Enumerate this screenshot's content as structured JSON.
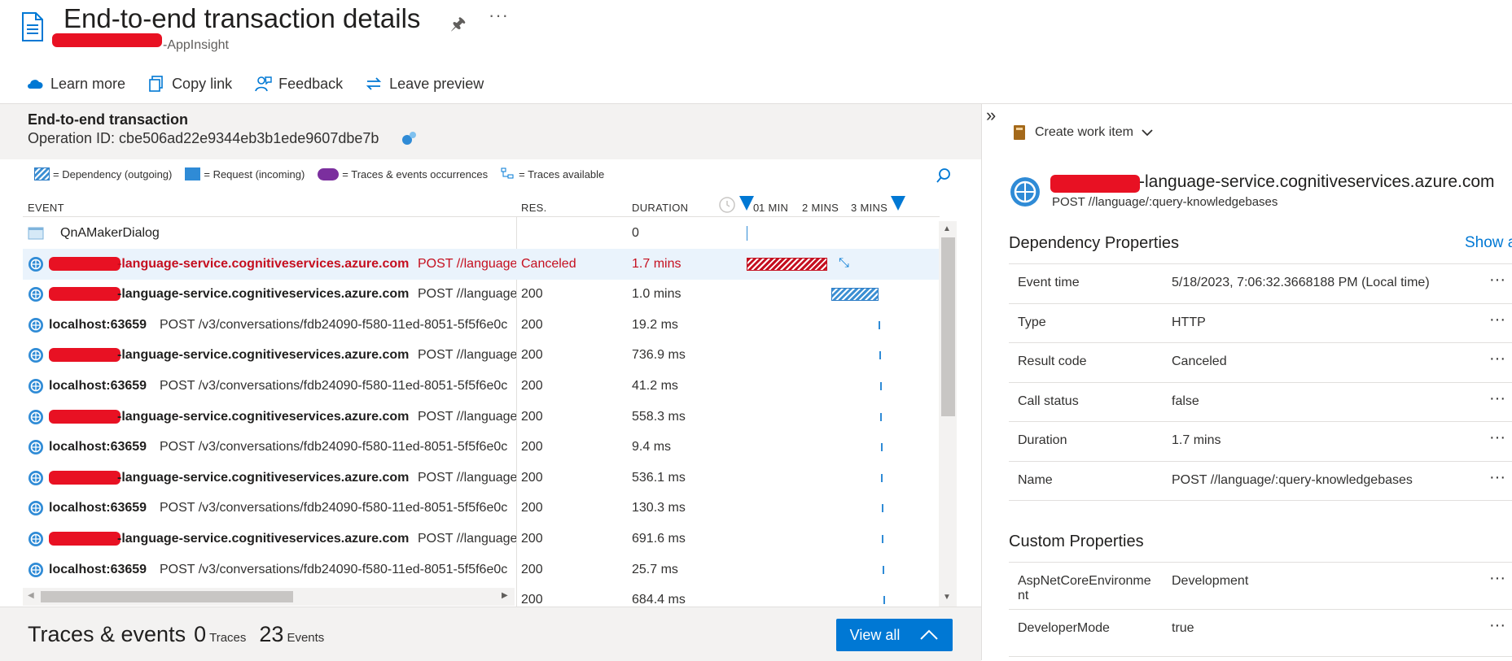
{
  "header": {
    "title": "End-to-end transaction details",
    "subtitle_suffix": "-AppInsight",
    "more_label": "···"
  },
  "toolbar": {
    "learn_more": "Learn more",
    "copy_link": "Copy link",
    "feedback": "Feedback",
    "leave_preview": "Leave preview"
  },
  "transaction": {
    "title": "End-to-end transaction",
    "operation_id": "Operation ID: cbe506ad22e9344eb3b1ede9607dbe7b"
  },
  "legend": {
    "dependency": "= Dependency (outgoing)",
    "request": "= Request (incoming)",
    "traces": "= Traces & events occurrences",
    "traces_available": "= Traces available"
  },
  "columns": {
    "event": "EVENT",
    "res": "RES.",
    "duration": "DURATION",
    "tick0": "0",
    "tick1": "1 MIN",
    "tick2": "2 MINS",
    "tick3": "3 MINS"
  },
  "rows": [
    {
      "name": "QnAMakerDialog",
      "detail": "",
      "res": "",
      "duration": "0",
      "bar_start": 0.0,
      "bar_len": 0.0
    },
    {
      "name": "-language-service.cognitiveservices.azure.com",
      "detail": "POST //language",
      "res": "Canceled",
      "duration": "1.7 mins",
      "bar_start": 0.0,
      "bar_len": 1.7
    },
    {
      "name": "-language-service.cognitiveservices.azure.com",
      "detail": "POST //language",
      "res": "200",
      "duration": "1.0 mins",
      "bar_start": 1.8,
      "bar_len": 1.0
    },
    {
      "name": "localhost:63659",
      "detail": "POST /v3/conversations/fdb24090-f580-11ed-8051-5f5f6e0c",
      "res": "200",
      "duration": "19.2 ms",
      "bar_start": 2.8,
      "bar_len": 0.0
    },
    {
      "name": "-language-service.cognitiveservices.azure.com",
      "detail": "POST //language",
      "res": "200",
      "duration": "736.9 ms",
      "bar_start": 2.81,
      "bar_len": 0.01
    },
    {
      "name": "localhost:63659",
      "detail": "POST /v3/conversations/fdb24090-f580-11ed-8051-5f5f6e0c",
      "res": "200",
      "duration": "41.2 ms",
      "bar_start": 2.82,
      "bar_len": 0.0
    },
    {
      "name": "-language-service.cognitiveservices.azure.com",
      "detail": "POST //language",
      "res": "200",
      "duration": "558.3 ms",
      "bar_start": 2.83,
      "bar_len": 0.01
    },
    {
      "name": "localhost:63659",
      "detail": "POST /v3/conversations/fdb24090-f580-11ed-8051-5f5f6e0c",
      "res": "200",
      "duration": "9.4 ms",
      "bar_start": 2.84,
      "bar_len": 0.0
    },
    {
      "name": "-language-service.cognitiveservices.azure.com",
      "detail": "POST //language",
      "res": "200",
      "duration": "536.1 ms",
      "bar_start": 2.85,
      "bar_len": 0.01
    },
    {
      "name": "localhost:63659",
      "detail": "POST /v3/conversations/fdb24090-f580-11ed-8051-5f5f6e0c",
      "res": "200",
      "duration": "130.3 ms",
      "bar_start": 2.86,
      "bar_len": 0.0
    },
    {
      "name": "-language-service.cognitiveservices.azure.com",
      "detail": "POST //language",
      "res": "200",
      "duration": "691.6 ms",
      "bar_start": 2.87,
      "bar_len": 0.01
    },
    {
      "name": "localhost:63659",
      "detail": "POST /v3/conversations/fdb24090-f580-11ed-8051-5f5f6e0c",
      "res": "200",
      "duration": "25.7 ms",
      "bar_start": 2.88,
      "bar_len": 0.0
    },
    {
      "name": "",
      "detail": "",
      "res": "200",
      "duration": "684.4 ms",
      "bar_start": 2.89,
      "bar_len": 0.01
    }
  ],
  "footer": {
    "title": "Traces & events",
    "traces_count": "0",
    "traces_label": "Traces",
    "events_count": "23",
    "events_label": "Events",
    "view_all": "View all"
  },
  "right_panel": {
    "collapse": "»",
    "create_work_item": "Create work item",
    "name_suffix": "-language-service.cognitiveservices.azure.com",
    "name_sub": "POST //language/:query-knowledgebases",
    "dependency_heading": "Dependency Properties",
    "show_all": "Show a",
    "properties": [
      {
        "label": "Event time",
        "value": "5/18/2023, 7:06:32.3668188 PM (Local time)"
      },
      {
        "label": "Type",
        "value": "HTTP"
      },
      {
        "label": "Result code",
        "value": "Canceled"
      },
      {
        "label": "Call status",
        "value": "false"
      },
      {
        "label": "Duration",
        "value": "1.7 mins"
      },
      {
        "label": "Name",
        "value": "POST //language/:query-knowledgebases"
      }
    ],
    "custom_heading": "Custom Properties",
    "custom": [
      {
        "label": "AspNetCoreEnvironme nt",
        "value": "Development"
      },
      {
        "label": "DeveloperMode",
        "value": "true"
      }
    ]
  },
  "colors": {
    "accent": "#0078d4",
    "error": "#c50f1f",
    "dependency": "#2f8bd6",
    "traces": "#7b2f9e"
  }
}
